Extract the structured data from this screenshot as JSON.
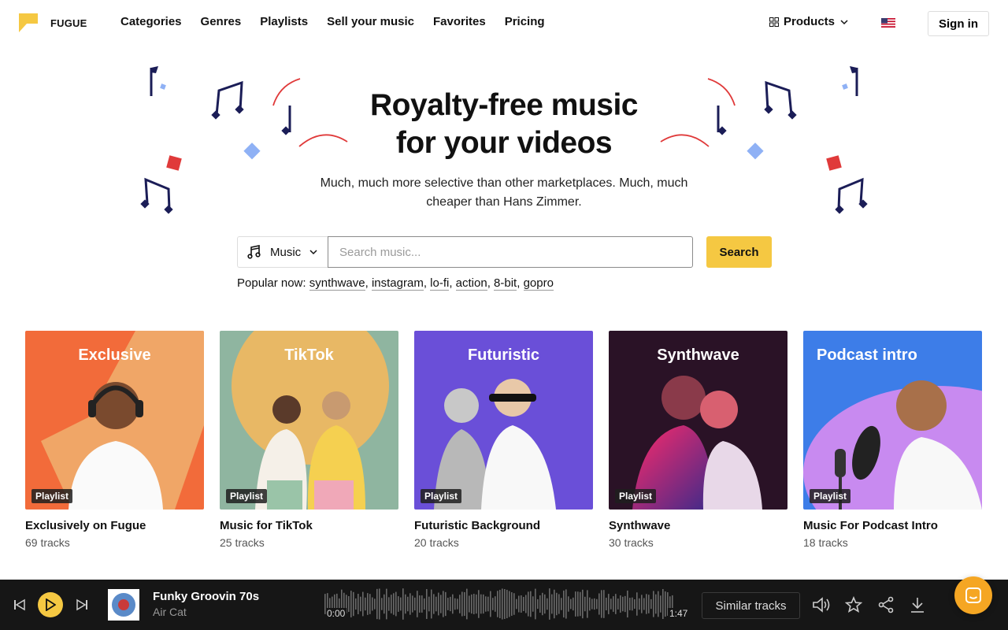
{
  "brand": {
    "name": "FUGUE"
  },
  "nav": {
    "links": [
      "Categories",
      "Genres",
      "Playlists",
      "Sell your music",
      "Favorites",
      "Pricing"
    ],
    "products_label": "Products",
    "signin_label": "Sign in"
  },
  "hero": {
    "title_line1": "Royalty-free music",
    "title_line2": "for your videos",
    "subtitle": "Much, much more selective than other marketplaces. Much, much cheaper than Hans Zimmer."
  },
  "search": {
    "type_label": "Music",
    "placeholder": "Search music...",
    "button_label": "Search",
    "popular_label": "Popular now:",
    "popular_tags": [
      "synthwave",
      "instagram",
      "lo-fi",
      "action",
      "8-bit",
      "gopro"
    ]
  },
  "playlists": [
    {
      "image_title": "Exclusive",
      "badge": "Playlist",
      "title": "Exclusively on Fugue",
      "tracks": "69 tracks",
      "bg": "#f26b3a"
    },
    {
      "image_title": "TikTok",
      "badge": "Playlist",
      "title": "Music for TikTok",
      "tracks": "25 tracks",
      "bg": "#8fb5a0"
    },
    {
      "image_title": "Futuristic",
      "badge": "Playlist",
      "title": "Futuristic Background",
      "tracks": "20 tracks",
      "bg": "#6a4fd8"
    },
    {
      "image_title": "Synthwave",
      "badge": "Playlist",
      "title": "Synthwave",
      "tracks": "30 tracks",
      "bg": "#3a1a2e"
    },
    {
      "image_title": "Podcast intro",
      "badge": "Playlist",
      "title": "Music For Podcast Intro",
      "tracks": "18 tracks",
      "bg": "#3d7de8"
    }
  ],
  "player": {
    "track_title": "Funky Groovin 70s",
    "artist": "Air Cat",
    "time_current": "0:00",
    "time_total": "1:47",
    "similar_label": "Similar tracks",
    "progress": 0
  },
  "colors": {
    "accent": "#f5c842",
    "player_bg": "#161616",
    "deco_navy": "#1b1d57",
    "deco_red": "#e03a3a",
    "deco_blue": "#8fb1f5"
  }
}
